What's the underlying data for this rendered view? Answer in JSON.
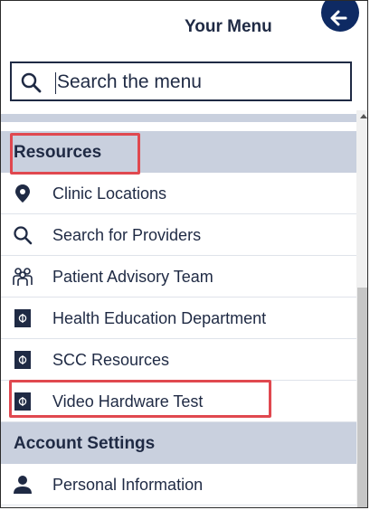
{
  "header": {
    "title": "Your Menu",
    "back_icon": "arrow-left-icon"
  },
  "search": {
    "placeholder": "Search the menu",
    "value": ""
  },
  "sections": [
    {
      "title": "Resources",
      "items": [
        {
          "label": "Clinic Locations",
          "icon": "map-pin-icon"
        },
        {
          "label": "Search for Providers",
          "icon": "search-icon"
        },
        {
          "label": "Patient Advisory Team",
          "icon": "people-group-icon"
        },
        {
          "label": "Health Education Department",
          "icon": "document-icon"
        },
        {
          "label": "SCC Resources",
          "icon": "document-icon"
        },
        {
          "label": "Video Hardware Test",
          "icon": "document-icon"
        }
      ]
    },
    {
      "title": "Account Settings",
      "items": [
        {
          "label": "Personal Information",
          "icon": "user-icon"
        }
      ]
    }
  ],
  "colors": {
    "navy": "#1f2a44",
    "back_button": "#0e2a63",
    "section_bg": "#c9d0de",
    "highlight": "#e0484f"
  }
}
